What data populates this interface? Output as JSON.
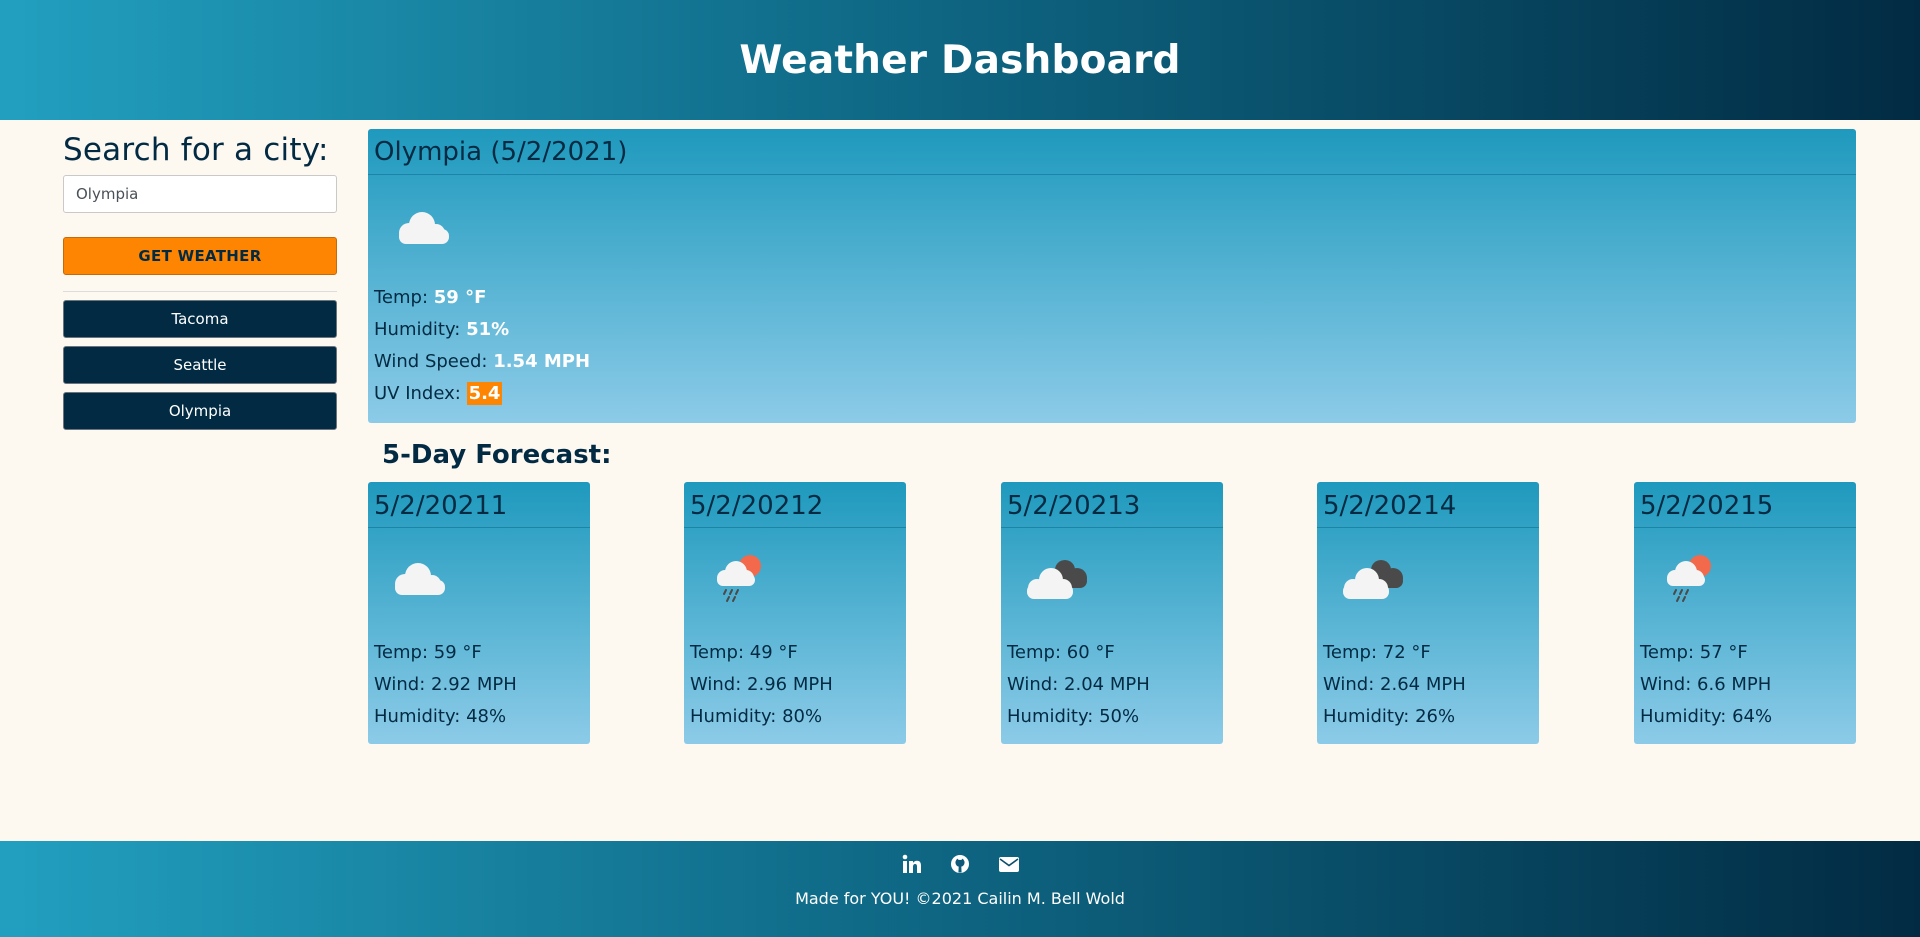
{
  "header": {
    "title": "Weather Dashboard"
  },
  "sidebar": {
    "heading": "Search for a city:",
    "search_value": "Olympia",
    "get_weather_label": "Get Weather",
    "history": [
      "Tacoma",
      "Seattle",
      "Olympia"
    ]
  },
  "current": {
    "title": "Olympia (5/2/2021)",
    "icon": "cloud-icon",
    "temp_label": "Temp:",
    "temp_value": "59 °F",
    "humidity_label": "Humidity:",
    "humidity_value": "51%",
    "wind_label": "Wind Speed:",
    "wind_value": "1.54 MPH",
    "uv_label": "UV Index:",
    "uv_value": "5.4"
  },
  "forecast": {
    "title": "5-Day Forecast:",
    "days": [
      {
        "date": "5/2/20211",
        "icon": "cloud-icon",
        "temp": "Temp: 59 °F",
        "wind": "Wind: 2.92 MPH",
        "humidity": "Humidity: 48%"
      },
      {
        "date": "5/2/20212",
        "icon": "rain-sun-icon",
        "temp": "Temp: 49 °F",
        "wind": "Wind: 2.96 MPH",
        "humidity": "Humidity: 80%"
      },
      {
        "date": "5/2/20213",
        "icon": "broken-clouds-icon",
        "temp": "Temp: 60 °F",
        "wind": "Wind: 2.04 MPH",
        "humidity": "Humidity: 50%"
      },
      {
        "date": "5/2/20214",
        "icon": "broken-clouds-icon",
        "temp": "Temp: 72 °F",
        "wind": "Wind: 2.64 MPH",
        "humidity": "Humidity: 26%"
      },
      {
        "date": "5/2/20215",
        "icon": "rain-sun-icon",
        "temp": "Temp: 57 °F",
        "wind": "Wind: 6.6 MPH",
        "humidity": "Humidity: 64%"
      }
    ]
  },
  "footer": {
    "icons": [
      "linkedin-icon",
      "github-icon",
      "envelope-icon"
    ],
    "credit": "Made for YOU! ©2021 Cailin M. Bell Wold"
  },
  "colors": {
    "header_dark": "#022b43",
    "header_light": "#229fbf",
    "accent_orange": "#fe8502",
    "background": "#fdf8f0"
  }
}
